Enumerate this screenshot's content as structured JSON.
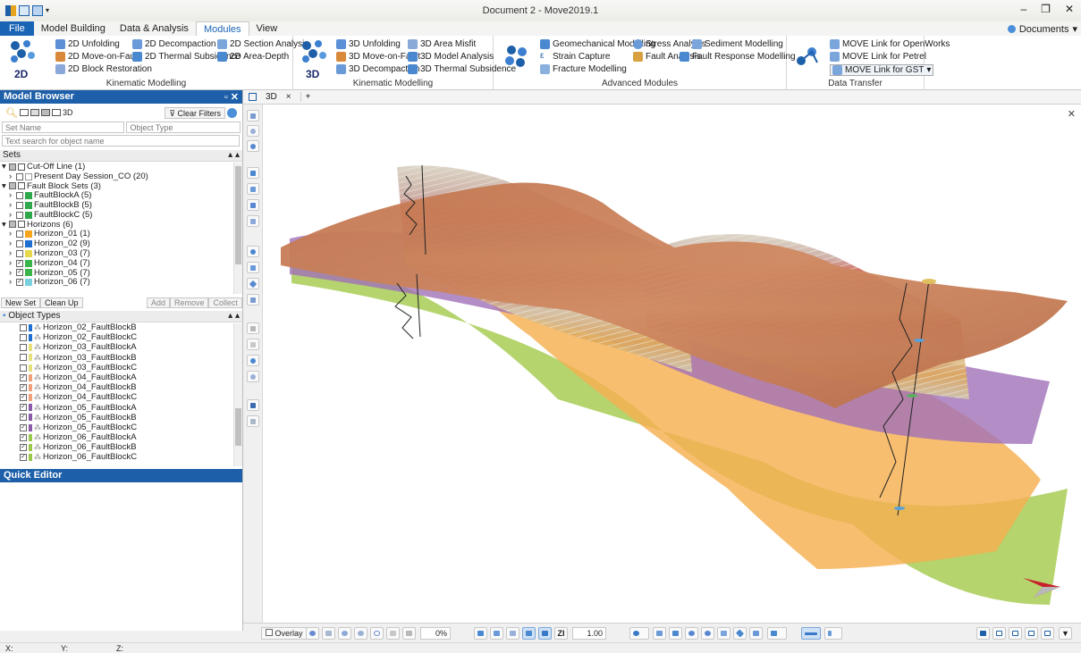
{
  "app": {
    "title": "Document 2 - Move2019.1",
    "documents_label": "Documents"
  },
  "menu": {
    "file": "File",
    "tabs": [
      "Model Building",
      "Data & Analysis",
      "Modules",
      "View"
    ],
    "active": "Modules"
  },
  "ribbon": {
    "kinematic2d": {
      "title": "Kinematic Modelling",
      "big_label": "2D",
      "items": [
        "2D Unfolding",
        "2D Move-on-Fault",
        "2D Block Restoration",
        "2D Decompaction",
        "2D Thermal Subsidence",
        "2D Section Analysis",
        "2D Area-Depth"
      ]
    },
    "kinematic3d": {
      "title": "Kinematic Modelling",
      "big_label": "3D",
      "items": [
        "3D Unfolding",
        "3D Move-on-Fault",
        "3D Decompaction",
        "3D Area Misfit",
        "3D Model Analysis",
        "3D Thermal Subsidence"
      ]
    },
    "advanced": {
      "title": "Advanced Modules",
      "items": [
        "Geomechanical Modelling",
        "Strain Capture",
        "Fracture Modelling",
        "Stress Analysis",
        "Fault Analysis",
        "Sediment Modelling",
        "Fault Response Modelling"
      ]
    },
    "transfer": {
      "title": "Data Transfer",
      "items": [
        "MOVE Link for OpenWorks",
        "MOVE Link for Petrel",
        "MOVE Link for GST"
      ]
    }
  },
  "view_tabs": {
    "tab": "3D",
    "close": "×",
    "add": "+"
  },
  "model_browser": {
    "title": "Model Browser",
    "view_3d_label": "3D",
    "clear_filters": "Clear Filters",
    "set_name_placeholder": "Set Name",
    "object_type_placeholder": "Object Type",
    "search_placeholder": "Text search for object name",
    "sets_header": "Sets",
    "sets": [
      {
        "label": "Cut-Off Line (1)",
        "level": 0,
        "folder": true
      },
      {
        "label": "Present Day Session_CO (20)",
        "level": 1,
        "color": "#ffffff"
      },
      {
        "label": "Fault Block Sets (3)",
        "level": 0,
        "folder": true
      },
      {
        "label": "FaultBlockA (5)",
        "level": 1,
        "color": "#2ea84a"
      },
      {
        "label": "FaultBlockB (5)",
        "level": 1,
        "color": "#2ea84a"
      },
      {
        "label": "FaultBlockC (5)",
        "level": 1,
        "color": "#2ea84a"
      },
      {
        "label": "Horizons (6)",
        "level": 0,
        "folder": true
      },
      {
        "label": "Horizon_01 (1)",
        "level": 1,
        "color": "#f7a51c"
      },
      {
        "label": "Horizon_02 (9)",
        "level": 1,
        "color": "#1f6fd1"
      },
      {
        "label": "Horizon_03 (7)",
        "level": 1,
        "color": "#e6d84a"
      },
      {
        "label": "Horizon_04 (7)",
        "level": 1,
        "color": "#3ab54a",
        "checked": true
      },
      {
        "label": "Horizon_05 (7)",
        "level": 1,
        "color": "#3ab54a",
        "checked": true
      },
      {
        "label": "Horizon_06 (7)",
        "level": 1,
        "color": "#7bd0e0",
        "checked": true
      }
    ],
    "buttons": [
      "New Set",
      "Clean Up",
      "Add",
      "Remove",
      "Collect"
    ],
    "object_types_header": "Object Types",
    "object_types": [
      {
        "label": "Horizon_02_FaultBlockB",
        "color": "#1f6fd1",
        "checked": false
      },
      {
        "label": "Horizon_02_FaultBlockC",
        "color": "#1f6fd1",
        "checked": false
      },
      {
        "label": "Horizon_03_FaultBlockA",
        "color": "#e6e07a",
        "checked": false
      },
      {
        "label": "Horizon_03_FaultBlockB",
        "color": "#e6e07a",
        "checked": false
      },
      {
        "label": "Horizon_03_FaultBlockC",
        "color": "#e6e07a",
        "checked": false
      },
      {
        "label": "Horizon_04_FaultBlockA",
        "color": "#f2a07a",
        "checked": true
      },
      {
        "label": "Horizon_04_FaultBlockB",
        "color": "#f2a07a",
        "checked": true
      },
      {
        "label": "Horizon_04_FaultBlockC",
        "color": "#f2a07a",
        "checked": true
      },
      {
        "label": "Horizon_05_FaultBlockA",
        "color": "#8a5aa8",
        "checked": true
      },
      {
        "label": "Horizon_05_FaultBlockB",
        "color": "#8a5aa8",
        "checked": true
      },
      {
        "label": "Horizon_05_FaultBlockC",
        "color": "#8a5aa8",
        "checked": true
      },
      {
        "label": "Horizon_06_FaultBlockA",
        "color": "#9ac84a",
        "checked": true
      },
      {
        "label": "Horizon_06_FaultBlockB",
        "color": "#9ac84a",
        "checked": true
      },
      {
        "label": "Horizon_06_FaultBlockC",
        "color": "#9ac84a",
        "checked": true
      }
    ]
  },
  "quick_editor": {
    "title": "Quick Editor"
  },
  "bottom_toolbar": {
    "overlay": "Overlay",
    "opacity": "0%",
    "zi_label": "ZI",
    "scale": "1.00"
  },
  "status": {
    "x": "X:",
    "y": "Y:",
    "z": "Z:"
  },
  "colors": {
    "accent": "#1d5fa8",
    "horizon_top": "#c87a52",
    "horizon_purple": "#a070b8",
    "horizon_orange": "#f5b050",
    "horizon_green": "#a8cc55"
  }
}
